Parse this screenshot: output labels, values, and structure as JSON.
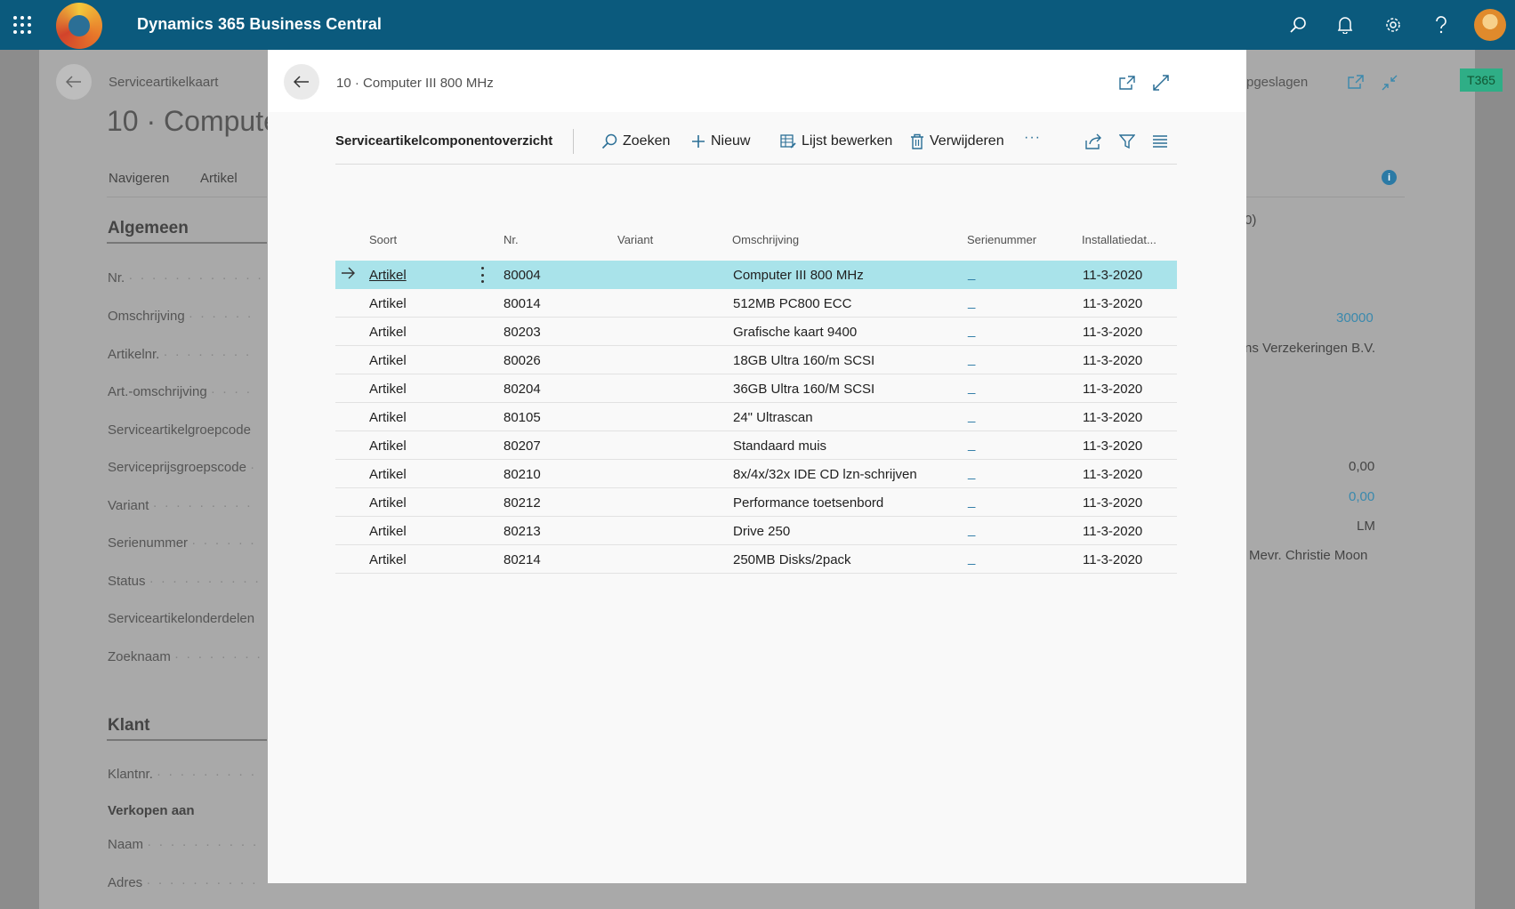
{
  "app": {
    "title": "Dynamics 365 Business Central"
  },
  "topbar_icons": [
    "apps-icon",
    "search-icon",
    "bell-icon",
    "gear-icon",
    "help-icon",
    "avatar"
  ],
  "background_page": {
    "breadcrumb": "Serviceartikelkaart",
    "title": "10 · Compute",
    "nav": [
      "Navigeren",
      "Artikel"
    ],
    "section_general": "Algemeen",
    "fields_general": [
      "Nr.",
      "Omschrijving",
      "Artikelnr.",
      "Art.-omschrijving",
      "Serviceartikelgroepcode",
      "Serviceprijsgroepscode",
      "Variant",
      "Serienummer",
      "Status",
      "Serviceartikelonderdelen",
      "Zoeknaam"
    ],
    "section_customer": "Klant",
    "customer_fields": {
      "klantnr": "Klantnr.",
      "sold_to": "Verkopen aan",
      "naam": "Naam",
      "adres": "Adres"
    },
    "right_header_text": "pgeslagen",
    "right_values": {
      "paren": "0)",
      "customer_no": "30000",
      "customer_name": "ns Verzekeringen B.V.",
      "value1": "0,00",
      "value2": "0,00",
      "code": "LM",
      "contact": "Mevr. Christie Moon"
    },
    "status_badge": "T365"
  },
  "modal": {
    "breadcrumb": "10 · Computer III 800 MHz",
    "page_title": "Serviceartikelcomponentoverzicht",
    "actions": {
      "search": "Zoeken",
      "new": "Nieuw",
      "edit_list": "Lijst bewerken",
      "delete": "Verwijderen",
      "more": "···"
    },
    "columns": [
      "Soort",
      "Nr.",
      "Variant",
      "Omschrijving",
      "Serienummer",
      "Installatiedat..."
    ],
    "rows": [
      {
        "soort": "Artikel",
        "nr": "80004",
        "variant": "",
        "omschrijving": "Computer III 800 MHz",
        "serienummer": "_",
        "datum": "11-3-2020"
      },
      {
        "soort": "Artikel",
        "nr": "80014",
        "variant": "",
        "omschrijving": "512MB PC800 ECC",
        "serienummer": "_",
        "datum": "11-3-2020"
      },
      {
        "soort": "Artikel",
        "nr": "80203",
        "variant": "",
        "omschrijving": "Grafische kaart 9400",
        "serienummer": "_",
        "datum": "11-3-2020"
      },
      {
        "soort": "Artikel",
        "nr": "80026",
        "variant": "",
        "omschrijving": "18GB Ultra 160/m SCSI",
        "serienummer": "_",
        "datum": "11-3-2020"
      },
      {
        "soort": "Artikel",
        "nr": "80204",
        "variant": "",
        "omschrijving": "36GB Ultra 160/M SCSI",
        "serienummer": "_",
        "datum": "11-3-2020"
      },
      {
        "soort": "Artikel",
        "nr": "80105",
        "variant": "",
        "omschrijving": "24\" Ultrascan",
        "serienummer": "_",
        "datum": "11-3-2020"
      },
      {
        "soort": "Artikel",
        "nr": "80207",
        "variant": "",
        "omschrijving": "Standaard muis",
        "serienummer": "_",
        "datum": "11-3-2020"
      },
      {
        "soort": "Artikel",
        "nr": "80210",
        "variant": "",
        "omschrijving": "8x/4x/32x IDE CD lzn-schrijven",
        "serienummer": "_",
        "datum": "11-3-2020"
      },
      {
        "soort": "Artikel",
        "nr": "80212",
        "variant": "",
        "omschrijving": "Performance toetsenbord",
        "serienummer": "_",
        "datum": "11-3-2020"
      },
      {
        "soort": "Artikel",
        "nr": "80213",
        "variant": "",
        "omschrijving": "Drive 250",
        "serienummer": "_",
        "datum": "11-3-2020"
      },
      {
        "soort": "Artikel",
        "nr": "80214",
        "variant": "",
        "omschrijving": "250MB Disks/2pack",
        "serienummer": "_",
        "datum": "11-3-2020"
      }
    ],
    "selected_row": 0
  },
  "colors": {
    "topbar": "#0b5a7d",
    "accent": "#2b7aa5",
    "selected_row": "#a9e3ea",
    "status_badge": "#2fae86"
  }
}
